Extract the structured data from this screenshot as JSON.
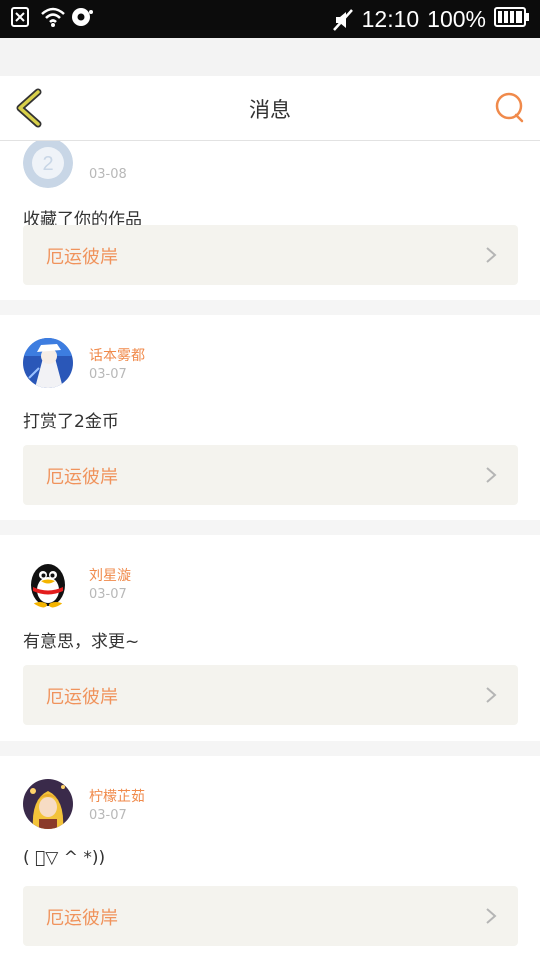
{
  "status_bar": {
    "time": "12:10",
    "battery": "100%",
    "icons": [
      "sim-off-icon",
      "wifi-icon",
      "data-sync-icon",
      "mute-icon",
      "battery-icon"
    ]
  },
  "header": {
    "title": "消息",
    "back_icon": "chevron-left-icon",
    "search_icon": "search-icon"
  },
  "colors": {
    "accent": "#f08a4b",
    "back_icon": "#c9c23a",
    "link_bg": "#f4f3ee"
  },
  "messages": [
    {
      "name": "",
      "date": "03-08",
      "text": "收藏了你的作品",
      "work": "厄运彼岸"
    },
    {
      "name": "话本雾都",
      "date": "03-07",
      "text": "打赏了2金币",
      "work": "厄运彼岸"
    },
    {
      "name": "刘星漩",
      "date": "03-07",
      "text": "有意思，求更~",
      "work": "厄运彼岸"
    },
    {
      "name": "柠檬芷茹",
      "date": "03-07",
      "text": "( ﾟ▽ ^ *))",
      "work": "厄运彼岸"
    }
  ]
}
